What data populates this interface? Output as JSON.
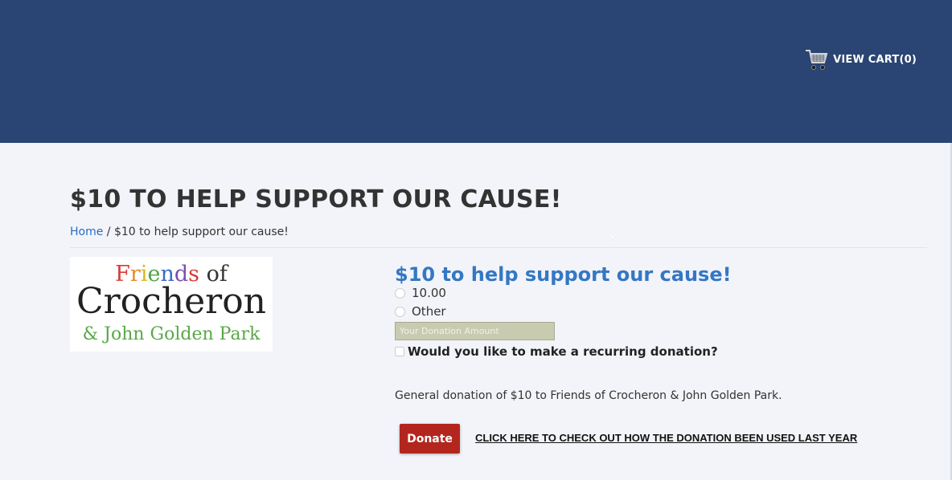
{
  "header": {
    "cart_label": "VIEW CART(0)",
    "cart_icon": "shopping-cart-icon",
    "background_color": "#2a4573"
  },
  "page": {
    "title": "$10 TO HELP SUPPORT OUR CAUSE!",
    "breadcrumb": {
      "home": "Home",
      "separator": " / ",
      "current": "$10 to help support our cause!"
    },
    "close_glyph": "×"
  },
  "logo": {
    "line1": "Friends of",
    "line2": "Crocheron",
    "line3": "& John Golden Park"
  },
  "product": {
    "title": "$10 to help support our cause!",
    "options": [
      "10.00",
      "Other"
    ],
    "amount_placeholder": "Your Donation Amount",
    "recurring_label": "Would you like to make a recurring donation?",
    "description": "General donation of $10 to Friends of Crocheron & John Golden Park.",
    "donate_label": "Donate",
    "usage_link": "CLICK HERE TO CHECK OUT HOW THE DONATION BEEN USED LAST YEAR"
  },
  "colors": {
    "title_blue": "#3577c4",
    "link_blue": "#2b6cc4",
    "donate_red": "#b3261e"
  }
}
